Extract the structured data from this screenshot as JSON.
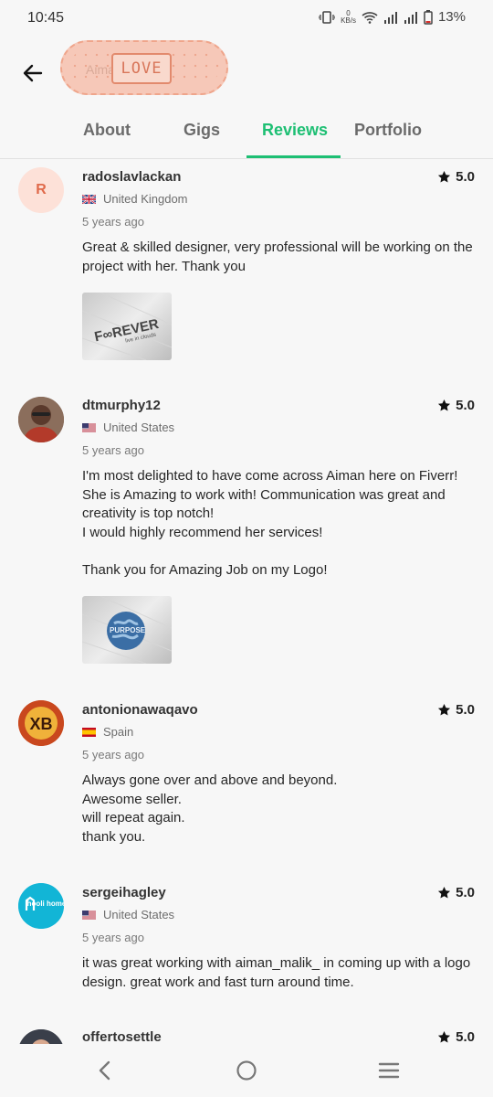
{
  "status_bar": {
    "time": "10:45",
    "net_speed_value": "0",
    "net_speed_unit": "KB/s",
    "battery": "13%"
  },
  "header": {
    "back_icon": "arrow-left-icon",
    "logo_text": "LOVE",
    "logo_faint_text": "Aiman"
  },
  "tabs": [
    {
      "label": "About",
      "active": false
    },
    {
      "label": "Gigs",
      "active": false
    },
    {
      "label": "Reviews",
      "active": true
    },
    {
      "label": "Portfolio",
      "active": false
    }
  ],
  "reviews": [
    {
      "username": "radoslavlackan",
      "country": "United Kingdom",
      "time_ago": "5 years ago",
      "rating": "5.0",
      "avatar_letter": "R",
      "text": "Great & skilled designer, very professional will be working on the project with her. Thank you",
      "image_text": "F∞REVER",
      "image_subtext": "live in clouds"
    },
    {
      "username": "dtmurphy12",
      "country": "United States",
      "time_ago": "5 years ago",
      "rating": "5.0",
      "text": "I'm most delighted to have come across Aiman here on Fiverr! She is Amazing to work with!  Communication was great and creativity is top notch!\nI would highly recommend her services!\n\nThank you for Amazing Job on my Logo!",
      "image_text": "PURPOSE"
    },
    {
      "username": "antonionawaqavo",
      "country": "Spain",
      "time_ago": "5 years ago",
      "rating": "5.0",
      "avatar_text": "XB",
      "text": "Always gone over and above and beyond.\nAwesome seller.\nwill repeat again.\nthank you."
    },
    {
      "username": "sergeihagley",
      "country": "United States",
      "time_ago": "5 years ago",
      "rating": "5.0",
      "avatar_text": "hooli home",
      "text": "it was great working with aiman_malik_ in coming up with a logo design. great work and fast turn around time."
    },
    {
      "username": "offertosettle",
      "rating": "5.0"
    }
  ],
  "nav_bar": {
    "back_icon": "nav-back-icon",
    "home_icon": "nav-home-icon",
    "menu_icon": "nav-menu-icon"
  },
  "colors": {
    "accent": "#1dbf73",
    "background": "#f7f7f7"
  }
}
